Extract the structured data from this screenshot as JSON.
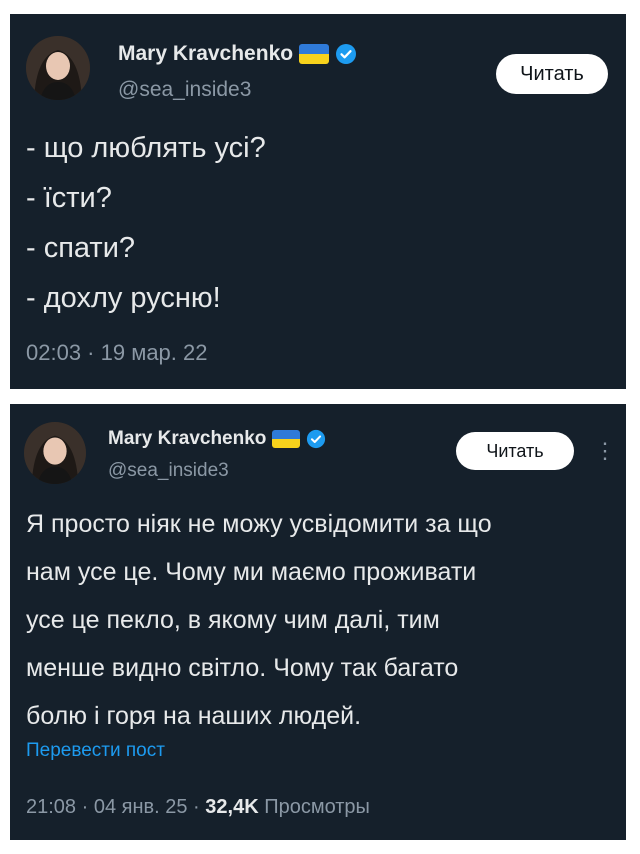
{
  "tweets": [
    {
      "author_name": "Mary Kravchenko",
      "handle": "@sea_inside3",
      "follow_label": "Читать",
      "lines": [
        "- що люблять усі?",
        "- їсти?",
        "- спати?",
        "- дохлу русню!"
      ],
      "timestamp": "02:03 · 19 мар. 22"
    },
    {
      "author_name": "Mary Kravchenko",
      "handle": "@sea_inside3",
      "follow_label": "Читать",
      "more_icon": "⋮",
      "lines": [
        "Я просто ніяк не можу усвідомити за що",
        "нам усе це. Чому ми маємо проживати",
        "усе це пекло, в якому чим далі, тим",
        "менше видно світло. Чому так багато",
        "болю і горя на наших людей."
      ],
      "translate_label": "Перевести пост",
      "meta_time": "21:08 · 04 янв. 25 · ",
      "meta_views": "32,4K",
      "meta_views_label": " Просмотры"
    }
  ],
  "icons": {
    "verified": "verified-badge-icon",
    "flag": "ukraine-flag-icon",
    "more": "more-options-icon"
  },
  "colors": {
    "background": "#15202b",
    "text": "#e7e9ea",
    "secondary": "#8b98a5",
    "link": "#1d9bf0",
    "verified": "#1d9bf0",
    "flag_blue": "#2f7ad8",
    "flag_yellow": "#f7d21c"
  }
}
